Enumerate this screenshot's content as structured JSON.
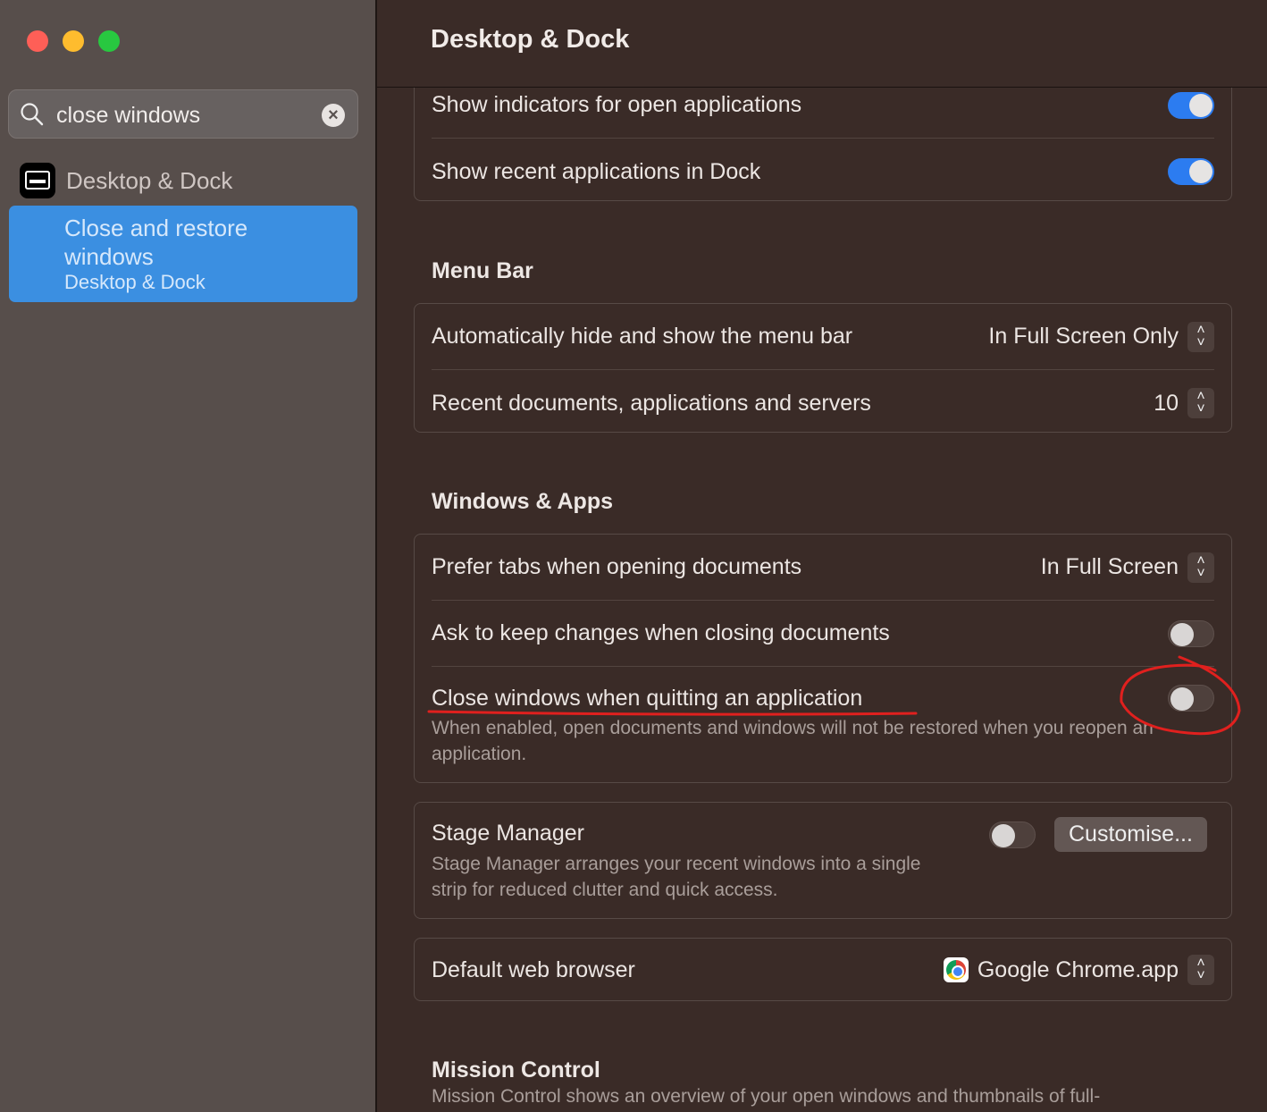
{
  "window": {
    "traffic_lights": {
      "close": "#fe5f57",
      "minimize": "#febc2e",
      "zoom": "#28c840"
    }
  },
  "sidebar": {
    "search": {
      "value": "close windows",
      "icon": "search-icon"
    },
    "section": "Desktop & Dock",
    "result": {
      "title": "Close and restore windows",
      "subtitle": "Desktop & Dock",
      "selected": true
    }
  },
  "header": {
    "title": "Desktop & Dock"
  },
  "dock_card": {
    "rows": [
      {
        "label": "Show indicators for open applications",
        "on": true
      },
      {
        "label": "Show recent applications in Dock",
        "on": true
      }
    ]
  },
  "menu_bar": {
    "heading": "Menu Bar",
    "rows": [
      {
        "label": "Automatically hide and show the menu bar",
        "value": "In Full Screen Only"
      },
      {
        "label": "Recent documents, applications and servers",
        "value": "10"
      }
    ]
  },
  "windows_apps": {
    "heading": "Windows & Apps",
    "prefer_tabs": {
      "label": "Prefer tabs when opening documents",
      "value": "In Full Screen"
    },
    "ask_keep": {
      "label": "Ask to keep changes when closing documents",
      "on": false
    },
    "close_windows": {
      "label": "Close windows when quitting an application",
      "on": false,
      "description": "When enabled, open documents and windows will not be restored when you reopen an application."
    }
  },
  "stage_manager": {
    "label": "Stage Manager",
    "on": false,
    "button": "Customise...",
    "description": "Stage Manager arranges your recent windows into a single strip for reduced clutter and quick access."
  },
  "browser": {
    "label": "Default web browser",
    "value": "Google Chrome.app"
  },
  "mission_control": {
    "heading": "Mission Control",
    "description": "Mission Control shows an overview of your open windows and thumbnails of full-"
  },
  "colors": {
    "accent": "#2c7cf0",
    "selection": "#3b8fe1",
    "annotation": "#e0201e"
  }
}
